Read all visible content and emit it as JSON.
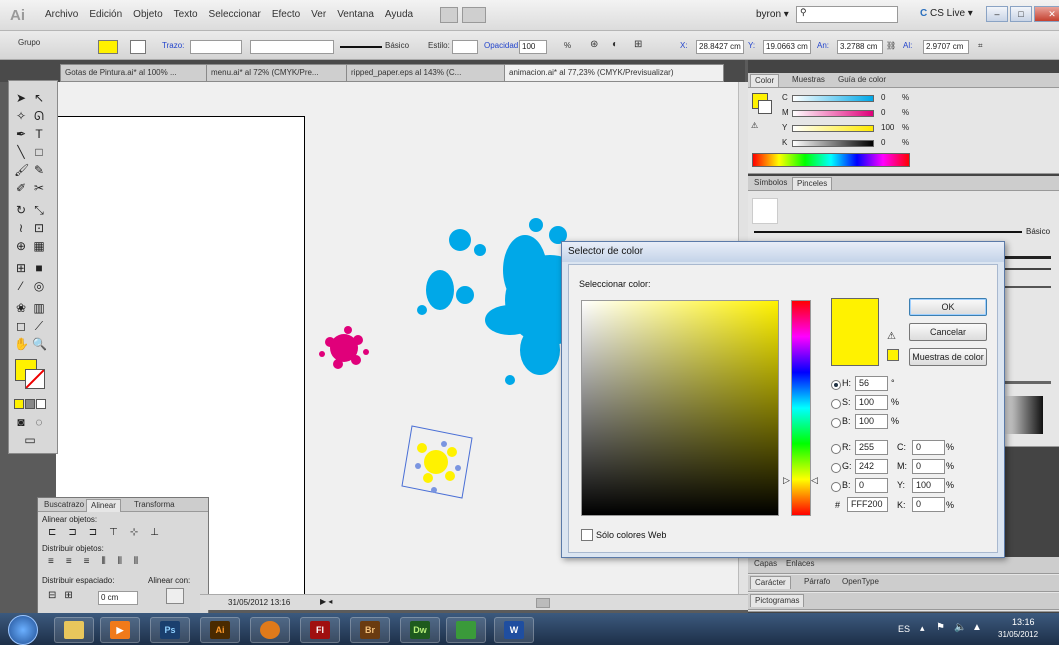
{
  "menubar": {
    "logo": "Ai",
    "items": [
      "Archivo",
      "Edición",
      "Objeto",
      "Texto",
      "Seleccionar",
      "Efecto",
      "Ver",
      "Ventana",
      "Ayuda"
    ],
    "user": "byron",
    "cslive": "CS Live"
  },
  "control": {
    "group_label": "Grupo",
    "stroke_label": "Trazo:",
    "basic_label": "Básico",
    "style_label": "Estilo:",
    "opacity_label": "Opacidad:",
    "opacity_value": "100",
    "percent": "%",
    "x_label": "X:",
    "x_value": "28.8427 cm",
    "y_label": "Y:",
    "y_value": "19.0663 cm",
    "w_label": "An:",
    "w_value": "3.2788 cm",
    "h_label": "Al:",
    "h_value": "2.9707 cm"
  },
  "tabs": [
    "Gotas de Pintura.ai* al 100% ...",
    "menu.ai* al 72% (CMYK/Pre...",
    "ripped_paper.eps al 143% (C...",
    "animacion.ai* al 77,23% (CMYK/Previsualizar)"
  ],
  "color_panel": {
    "tabs": [
      "Color",
      "Muestras",
      "Guía de color"
    ],
    "channels": [
      {
        "label": "C",
        "value": "0",
        "color": "#00a8e8"
      },
      {
        "label": "M",
        "value": "0",
        "color": "#e0007a"
      },
      {
        "label": "Y",
        "value": "100",
        "color": "#ffea00"
      },
      {
        "label": "K",
        "value": "0",
        "color": "#000000"
      }
    ],
    "percent": "%"
  },
  "brushes_panel": {
    "tabs": [
      "Símbolos",
      "Pinceles"
    ],
    "basic_label": "Básico"
  },
  "lower_panels": {
    "layers_tabs": [
      "Capas",
      "Enlaces"
    ],
    "char_tabs": [
      "Carácter",
      "Párrafo",
      "OpenType"
    ],
    "glyphs_tab": "Pictogramas"
  },
  "align_panel": {
    "tabs": [
      "Buscatrazo",
      "Alinear",
      "Transforma"
    ],
    "align_objects": "Alinear objetos:",
    "distribute_objects": "Distribuir objetos:",
    "distribute_spacing": "Distribuir espaciado:",
    "align_to": "Alinear con:",
    "spacing_value": "0 cm"
  },
  "status": {
    "date": "31/05/2012  13:16"
  },
  "dialog": {
    "title": "Selector de color",
    "select_label": "Seleccionar color:",
    "ok": "OK",
    "cancel": "Cancelar",
    "swatches": "Muestras de color",
    "h_label": "H:",
    "h_value": "56",
    "h_unit": "°",
    "s_label": "S:",
    "s_value": "100",
    "s_unit": "%",
    "b_label": "B:",
    "b_value": "100",
    "b_unit": "%",
    "r_label": "R:",
    "r_value": "255",
    "g_label": "G:",
    "g_value": "242",
    "bb_label": "B:",
    "bb_value": "0",
    "c_label": "C:",
    "c_value": "0",
    "m_label": "M:",
    "m_value": "0",
    "y_label": "Y:",
    "y_value": "100",
    "k_label": "K:",
    "k_value": "0",
    "pct": "%",
    "hex_label": "#",
    "hex_value": "FFF200",
    "web_only": "Sólo colores Web",
    "current_color": "#fff200"
  },
  "taskbar": {
    "apps": [
      "start",
      "explorer",
      "media",
      "Ps",
      "Ai",
      "firefox",
      "Fl",
      "Br",
      "Dw",
      "messenger",
      "W"
    ],
    "lang": "ES",
    "time": "13:16",
    "date": "31/05/2012"
  }
}
